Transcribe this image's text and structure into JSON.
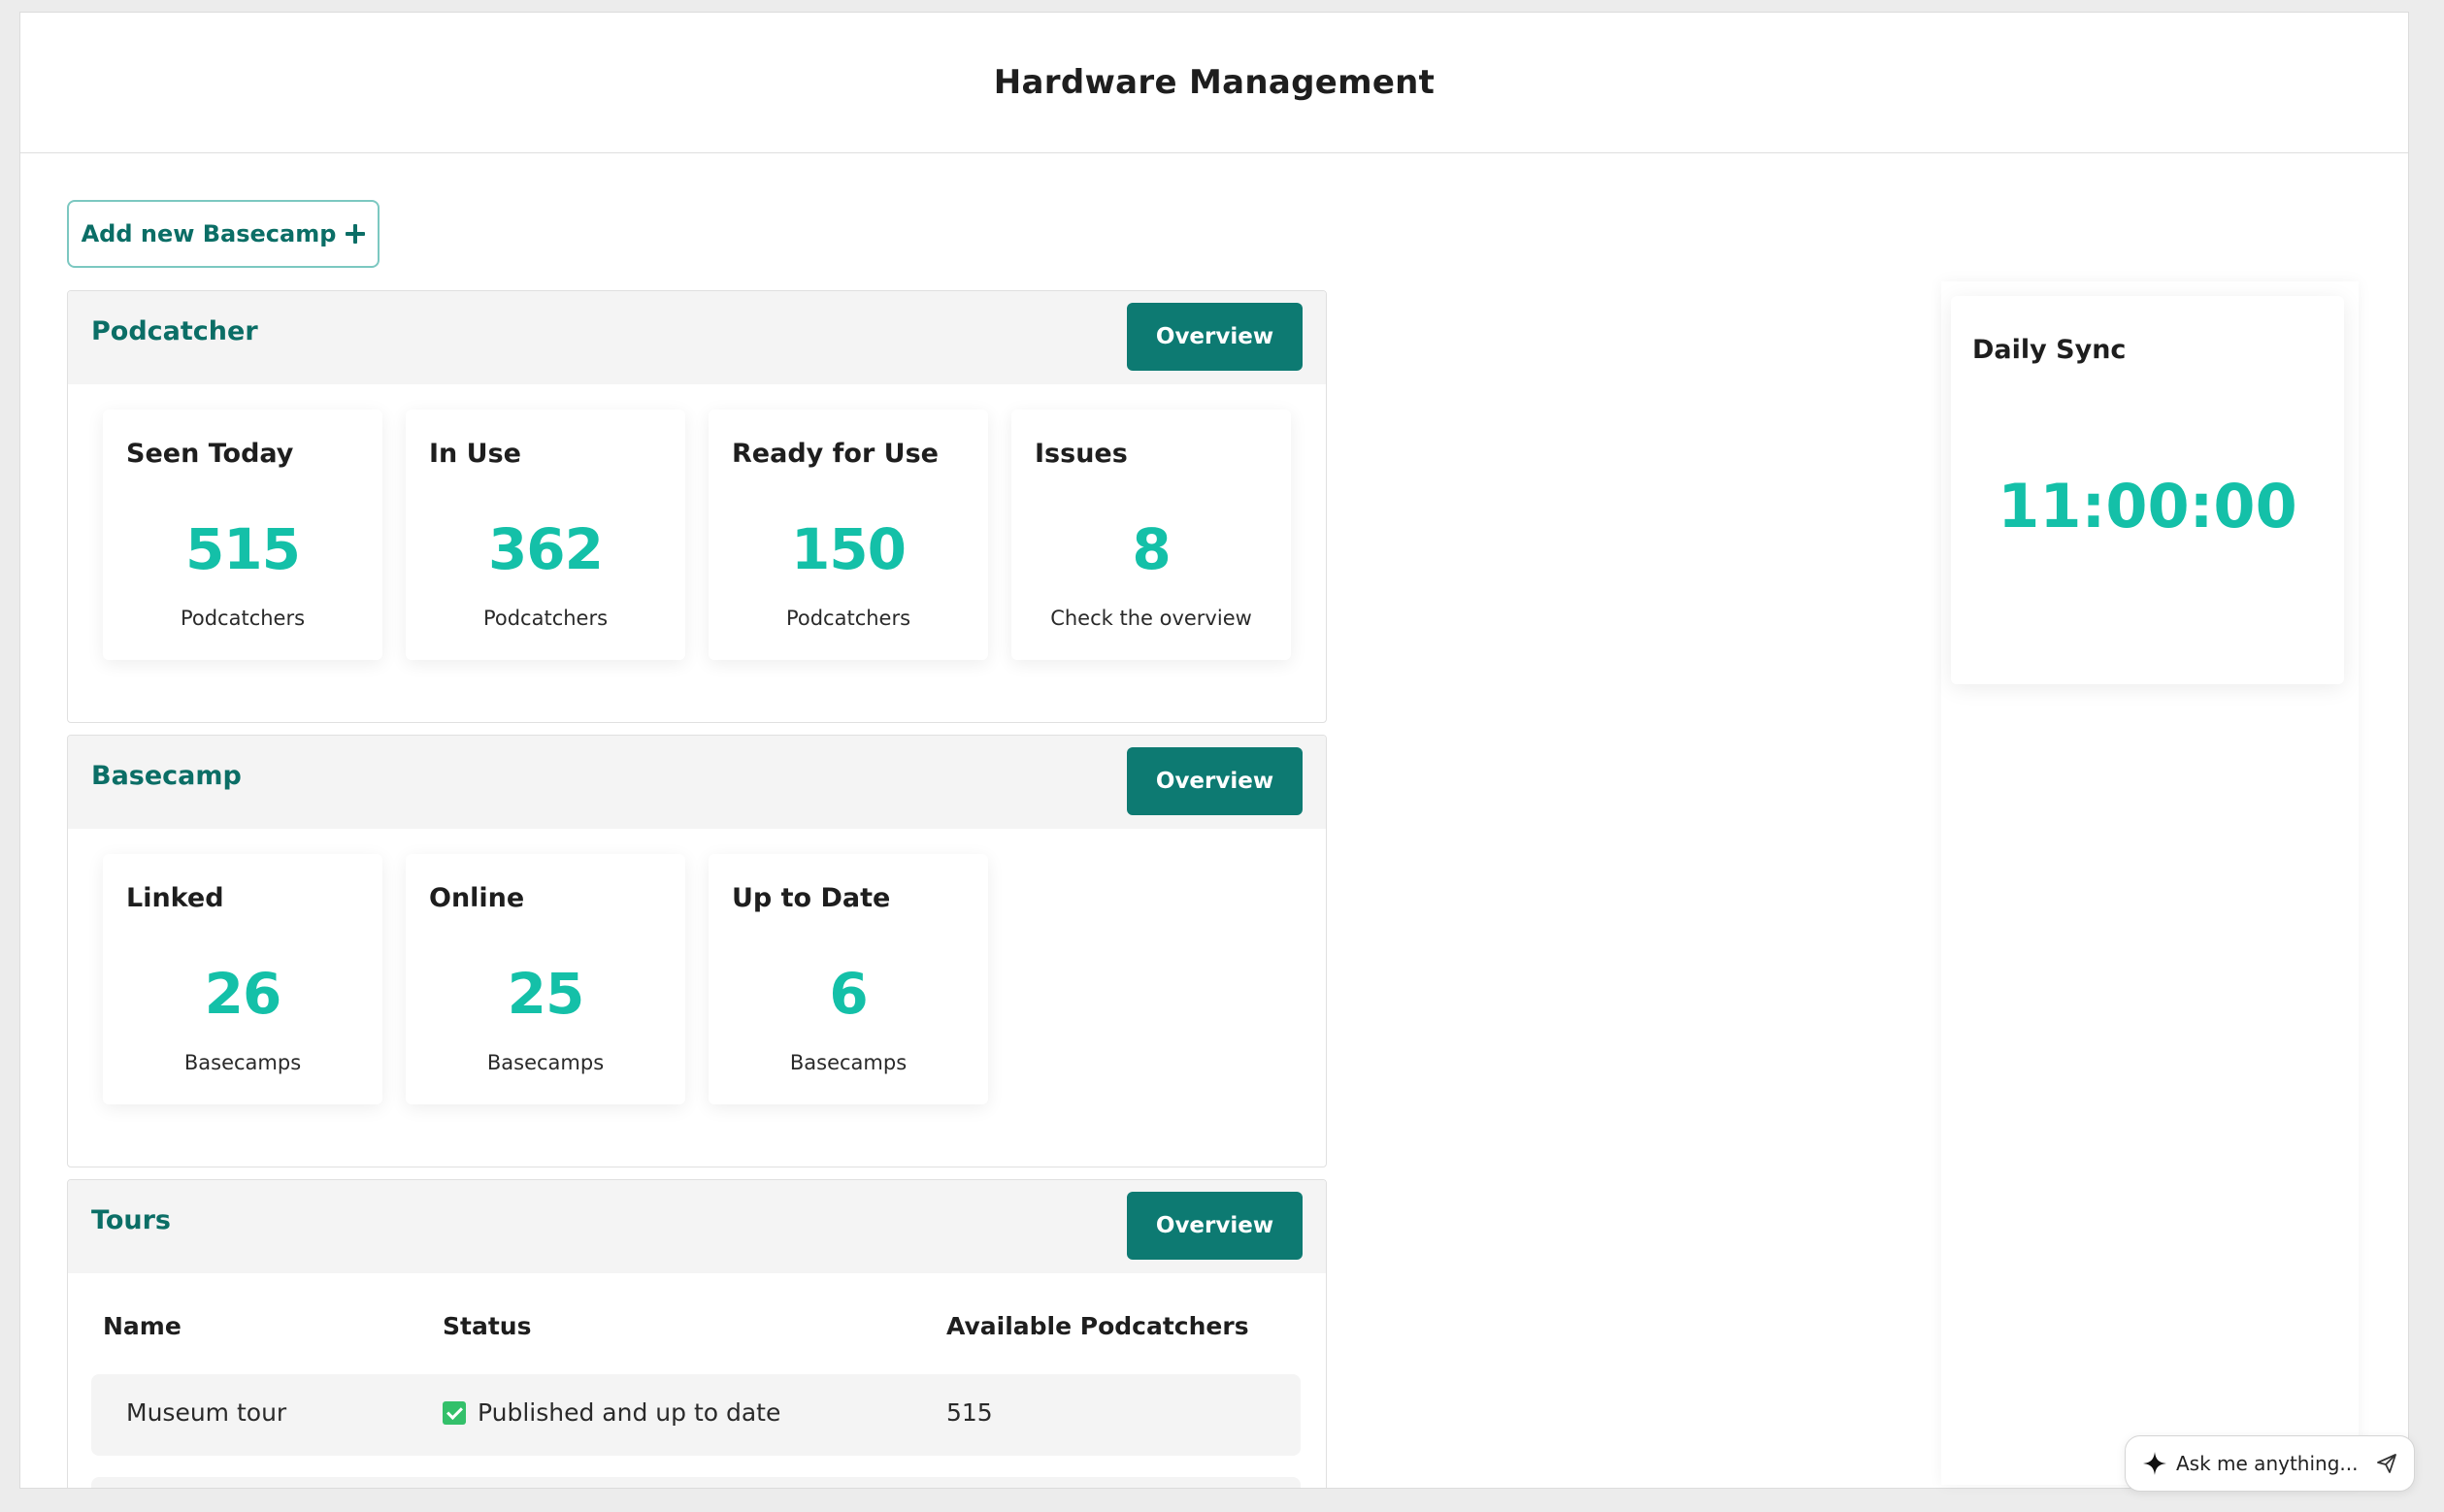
{
  "header": {
    "title": "Hardware Management"
  },
  "actions": {
    "add_basecamp": "Add new Basecamp"
  },
  "podcatcher": {
    "title": "Podcatcher",
    "overview_label": "Overview",
    "cards": [
      {
        "label": "Seen Today",
        "value": "515",
        "sub": "Podcatchers"
      },
      {
        "label": "In Use",
        "value": "362",
        "sub": "Podcatchers"
      },
      {
        "label": "Ready for Use",
        "value": "150",
        "sub": "Podcatchers"
      },
      {
        "label": "Issues",
        "value": "8",
        "sub": "Check the overview"
      }
    ]
  },
  "basecamp": {
    "title": "Basecamp",
    "overview_label": "Overview",
    "cards": [
      {
        "label": "Linked",
        "value": "26",
        "sub": "Basecamps"
      },
      {
        "label": "Online",
        "value": "25",
        "sub": "Basecamps"
      },
      {
        "label": "Up to Date",
        "value": "6",
        "sub": "Basecamps"
      }
    ]
  },
  "tours": {
    "title": "Tours",
    "overview_label": "Overview",
    "columns": [
      "Name",
      "Status",
      "Available Podcatchers"
    ],
    "rows": [
      {
        "name": "Museum tour",
        "status": "Published and up to date",
        "available": "515"
      }
    ]
  },
  "daily_sync": {
    "title": "Daily Sync",
    "time": "11:00:00"
  },
  "assistant": {
    "placeholder": "Ask me anything..."
  },
  "colors": {
    "accent": "#0d7a72",
    "value": "#14c0a8",
    "status_ok": "#33c06a"
  }
}
